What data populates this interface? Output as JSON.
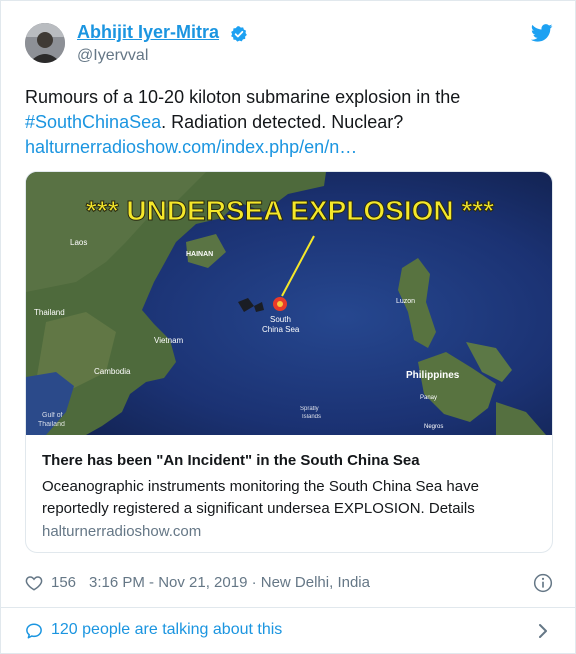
{
  "author": {
    "name": "Abhijit Iyer-Mitra",
    "handle": "@Iyervval",
    "verified_icon": "verified-badge-icon",
    "avatar_icon": "profile-photo"
  },
  "brand_icon": "twitter-bird-icon",
  "tweet": {
    "line1": "Rumours of a 10-20 kiloton submarine  explosion in the",
    "hashtag": "#SouthChinaSea",
    "line2_rest": ". Radiation detected. Nuclear?",
    "link": "halturnerradioshow.com/index.php/en/n…"
  },
  "card": {
    "image_headline": "*** UNDERSEA EXPLOSION ***",
    "map_labels": {
      "laos": "Laos",
      "hainan": "HAINAN",
      "thailand": "Thailand",
      "vietnam": "Vietnam",
      "cambodia": "Cambodia",
      "gulf1": "Gulf of",
      "gulf2": "Thailand",
      "scs1": "South",
      "scs2": "China Sea",
      "luzon": "Luzon",
      "philippines": "Philippines",
      "panay": "Panay",
      "spratly1": "Spratly",
      "spratly2": "Islands",
      "negros": "Negros"
    },
    "title": "There has been \"An Incident\" in the South China Sea",
    "description": "Oceanographic instruments monitoring the South China Sea have reportedly registered a significant undersea EXPLOSION.  Details",
    "domain": "halturnerradioshow.com"
  },
  "meta": {
    "likes": "156",
    "timestamp": "3:16 PM - Nov 21, 2019 · New Delhi, India"
  },
  "footer": {
    "talking": "120 people are talking about this"
  },
  "colors": {
    "link_blue": "#1b95e0",
    "secondary_text": "#657786",
    "headline_yellow": "#f5e82a"
  }
}
